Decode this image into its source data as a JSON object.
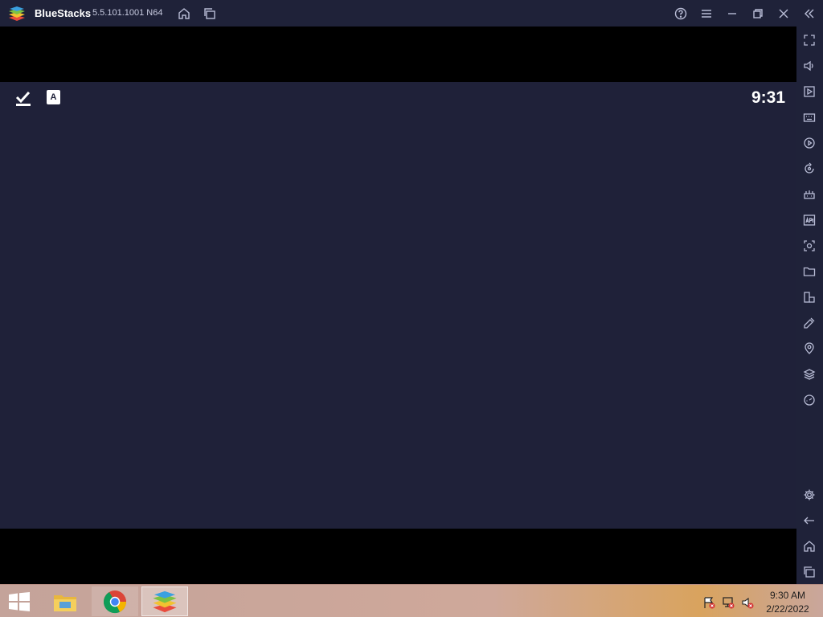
{
  "titlebar": {
    "app_name": "BlueStacks",
    "version": "5.5.101.1001 N64",
    "icons": [
      "home-icon",
      "multi-instance-icon",
      "help-icon",
      "menu-icon",
      "minimize-icon",
      "restore-icon",
      "close-icon",
      "collapse-sidebar-icon"
    ]
  },
  "android": {
    "status_icons": [
      "download-done-icon",
      "keyboard-a-icon"
    ],
    "time": "9:31",
    "background": "#1f2139"
  },
  "sidebar": {
    "icons": [
      "fullscreen-icon",
      "volume-icon",
      "media-icon",
      "keyboard-icon",
      "macro-icon",
      "rotate-icon",
      "controls-icon",
      "apk-icon",
      "screenshot-icon",
      "folder-icon",
      "multi-window-icon",
      "eco-mode-icon",
      "location-icon",
      "layers-icon",
      "performance-icon",
      "settings-icon",
      "back-icon",
      "home-icon",
      "recents-icon"
    ]
  },
  "taskbar": {
    "apps": [
      "start-icon",
      "file-explorer-icon",
      "chrome-icon",
      "bluestacks-icon"
    ],
    "tray": [
      "action-center-flag-icon",
      "network-icon",
      "volume-muted-icon"
    ],
    "clock": {
      "time": "9:30 AM",
      "date": "2/22/2022"
    }
  },
  "colors": {
    "chrome": "#1f2239",
    "android_bg": "#1f2139"
  }
}
